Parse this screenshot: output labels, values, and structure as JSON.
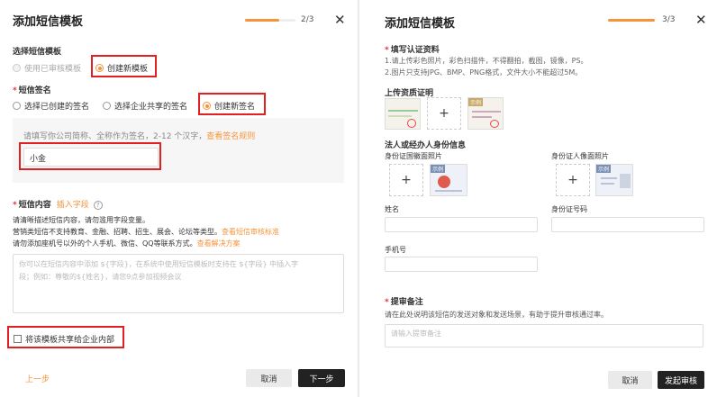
{
  "left": {
    "title": "添加短信模板",
    "step": "2/3",
    "progress": 0.67,
    "close_icon": "close-icon",
    "template_section_label": "选择短信模板",
    "template_options": [
      "使用已审核模板",
      "创建新模板"
    ],
    "signature_label": "短信签名",
    "signature_options": [
      "选择已创建的签名",
      "选择企业共享的签名",
      "创建新签名"
    ],
    "signature_hint": "请填写你公司简称、全称作为签名，2-12 个汉字，",
    "signature_hint_link": "查看签名规则",
    "signature_value": "小金",
    "content_label": "短信内容",
    "insert_field": "插入字段",
    "help_icon": "help-icon",
    "notice_line1": "请清晰描述短信内容，请勿滥用字段变量。",
    "notice_line2": "营销类短信不支持教育、金融、招聘、招生、展会、论坛等类型。",
    "notice_line2_link": "查看短信审核标准",
    "notice_line3": "请勿添加座机号以外的个人手机、微信、QQ等联系方式。",
    "notice_line3_link": "查看解决方案",
    "content_placeholder_line1": "你可以在短信内容中添加 ${字段}，在系统中使用短信模板时支持在 ${字段} 中插入字",
    "content_placeholder_line2": "段；例如：尊敬的${姓名}，请您9点参加视频会议",
    "share_checkbox_label": "将该模板共享给企业内部",
    "prev_label": "上一步",
    "cancel_label": "取消",
    "next_label": "下一步"
  },
  "right": {
    "title": "添加短信模板",
    "step": "3/3",
    "progress": 1.0,
    "close_icon": "close-icon",
    "cert_label": "填写认证资料",
    "cert_line1": "1.请上传彩色照片，彩色扫描件，不得翻拍，截图，镜像，PS。",
    "cert_line2": "2.图片只支持JPG、BMP、PNG格式，文件大小不能超过5M。",
    "upload_cert_label": "上传资质证明",
    "sample_tag": "示例",
    "id_info_label": "法人或经办人身份信息",
    "id_front_label": "身份证国徽面照片",
    "id_back_label": "身份证人像面照片",
    "name_label": "姓名",
    "id_number_label": "身份证号码",
    "phone_label": "手机号",
    "remark_label": "提审备注",
    "remark_desc": "请在此处说明该短信的发送对象和发送场景，有助于提升审核通过率。",
    "remark_placeholder": "请输入提审备注",
    "cancel_label": "取消",
    "submit_label": "发起审核"
  }
}
